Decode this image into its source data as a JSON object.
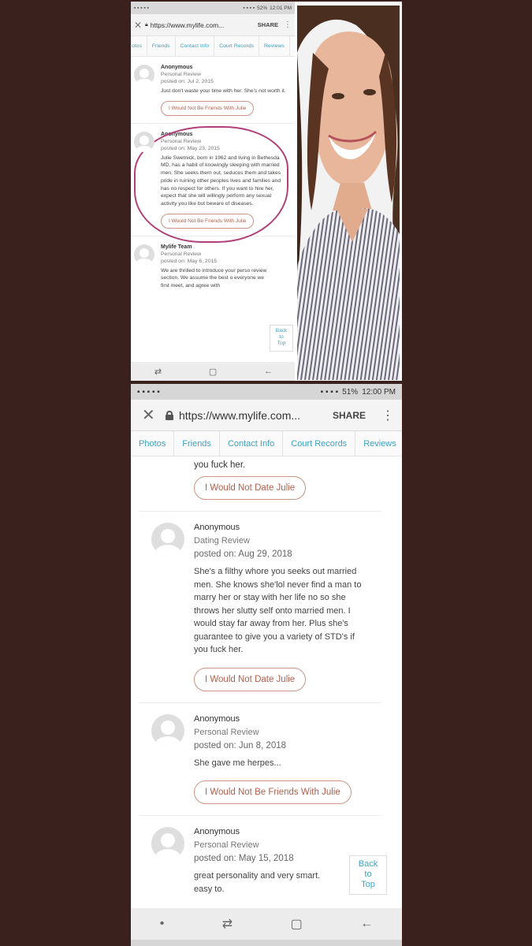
{
  "top": {
    "status_bar": {
      "battery": "52%",
      "time": "12:01 PM"
    },
    "url_bar": {
      "close": "✕",
      "url": "https://www.mylife.com...",
      "share": "SHARE",
      "menu": "⋮"
    },
    "tabs": [
      "otos",
      "Friends",
      "Contact Info",
      "Court Records",
      "Reviews"
    ],
    "reviews": [
      {
        "name": "Anonymous",
        "type": "Personal Review",
        "date": "posted on: Jul 2, 2015",
        "body": "Just don't waste your time with her. She's not worth it.",
        "button": "I Would Not Be Friends With Julie"
      },
      {
        "name": "Anonymous",
        "type": "Personal Review",
        "date": "posted on: May 23, 2015",
        "body": "Julie Swetnick, born in 1962 and living in Bethesda MD, has a habit of knowingly sleeping with married men. She seeks them out, seduces them and takes pride in ruining other peoples lives and families and has no respect for others. If you want to hire her, expect that she will willingly perform any sexual activity you like but beware of diseases.",
        "button": "I Would Not Be Friends With Julie"
      },
      {
        "name": "Mylife Team",
        "type": "Personal Review",
        "date": "posted on: May 6, 2015",
        "body": "We are thrilled to introduce your perso review section. We assume the best o everyone we first meet, and agree with",
        "button": ""
      }
    ],
    "back_to_top": [
      "Back",
      "to",
      "Top"
    ],
    "nav": [
      "⇄",
      "▢",
      "←"
    ]
  },
  "bottom": {
    "status_bar": {
      "battery": "51%",
      "time": "12:00 PM"
    },
    "url_bar": {
      "close": "✕",
      "url": "https://www.mylife.com...",
      "share": "SHARE",
      "menu": "⋮"
    },
    "tabs": [
      "Photos",
      "Friends",
      "Contact Info",
      "Court Records",
      "Reviews"
    ],
    "prev_tail": "you fuck her.",
    "prev_button": "I Would Not Date Julie",
    "reviews": [
      {
        "name": "Anonymous",
        "type": "Dating Review",
        "date": "posted on: Aug 29, 2018",
        "body": "She's a filthy whore you seeks out married men. She knows she'lol never find a man to marry her or stay with her life no so she throws her slutty self onto married men. I would stay far away from her. Plus she's guarantee to give you a variety of STD's if you fuck her.",
        "button": "I Would Not Date Julie"
      },
      {
        "name": "Anonymous",
        "type": "Personal Review",
        "date": "posted on: Jun 8, 2018",
        "body": "She gave me herpes...",
        "button": "I Would Not Be Friends With Julie"
      },
      {
        "name": "Anonymous",
        "type": "Personal Review",
        "date": "posted on: May 15, 2018",
        "body": "great personality and very smart. easy to.",
        "button": ""
      }
    ],
    "back_to_top": [
      "Back",
      "to",
      "Top"
    ],
    "nav": [
      "•",
      "⇄",
      "▢",
      "←"
    ]
  }
}
